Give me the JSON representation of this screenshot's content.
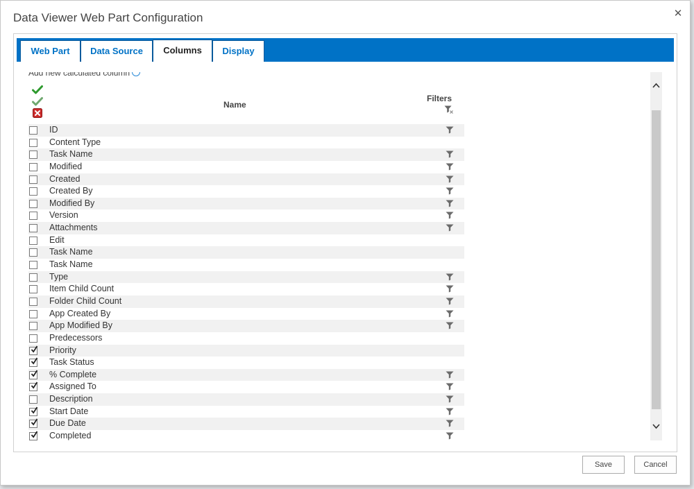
{
  "dialog": {
    "title": "Data Viewer Web Part Configuration",
    "close_glyph": "✕"
  },
  "tabs": [
    {
      "label": "Web Part",
      "active": false
    },
    {
      "label": "Data Source",
      "active": false
    },
    {
      "label": "Columns",
      "active": true
    },
    {
      "label": "Display",
      "active": false
    }
  ],
  "columns_panel": {
    "add_calculated_label": "Add new calculated column",
    "header_name": "Name",
    "header_filters": "Filters",
    "icons": {
      "check_all": "check-all-icon",
      "check_default": "check-default-icon",
      "uncheck_all": "uncheck-all-icon",
      "clear_filters": "clear-filters-icon",
      "filter": "filter-icon"
    },
    "rows": [
      {
        "name": "ID",
        "checked": false,
        "filter": true
      },
      {
        "name": "Content Type",
        "checked": false,
        "filter": false
      },
      {
        "name": "Task Name",
        "checked": false,
        "filter": true
      },
      {
        "name": "Modified",
        "checked": false,
        "filter": true
      },
      {
        "name": "Created",
        "checked": false,
        "filter": true
      },
      {
        "name": "Created By",
        "checked": false,
        "filter": true
      },
      {
        "name": "Modified By",
        "checked": false,
        "filter": true
      },
      {
        "name": "Version",
        "checked": false,
        "filter": true
      },
      {
        "name": "Attachments",
        "checked": false,
        "filter": true
      },
      {
        "name": "Edit",
        "checked": false,
        "filter": false
      },
      {
        "name": "Task Name",
        "checked": false,
        "filter": false
      },
      {
        "name": "Task Name",
        "checked": false,
        "filter": false
      },
      {
        "name": "Type",
        "checked": false,
        "filter": true
      },
      {
        "name": "Item Child Count",
        "checked": false,
        "filter": true
      },
      {
        "name": "Folder Child Count",
        "checked": false,
        "filter": true
      },
      {
        "name": "App Created By",
        "checked": false,
        "filter": true
      },
      {
        "name": "App Modified By",
        "checked": false,
        "filter": true
      },
      {
        "name": "Predecessors",
        "checked": false,
        "filter": false
      },
      {
        "name": "Priority",
        "checked": true,
        "filter": false
      },
      {
        "name": "Task Status",
        "checked": true,
        "filter": false
      },
      {
        "name": "% Complete",
        "checked": true,
        "filter": true
      },
      {
        "name": "Assigned To",
        "checked": true,
        "filter": true
      },
      {
        "name": "Description",
        "checked": false,
        "filter": true
      },
      {
        "name": "Start Date",
        "checked": true,
        "filter": true
      },
      {
        "name": "Due Date",
        "checked": true,
        "filter": true
      },
      {
        "name": "Completed",
        "checked": true,
        "filter": true
      }
    ]
  },
  "footer": {
    "save_label": "Save",
    "cancel_label": "Cancel"
  },
  "colors": {
    "accent": "#0072c6",
    "check_green": "#2e9a2e",
    "uncheck_red": "#cc2b2b"
  }
}
